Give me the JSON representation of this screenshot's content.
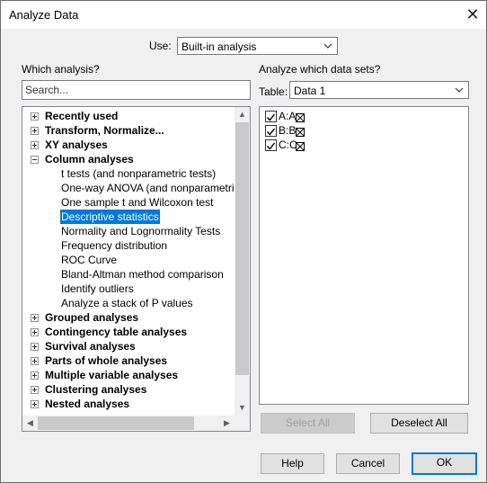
{
  "window": {
    "title": "Analyze Data",
    "close_glyph": "✕"
  },
  "use": {
    "label": "Use:",
    "value": "Built-in analysis"
  },
  "left": {
    "heading": "Which analysis?",
    "search_placeholder": "Search...",
    "tree": {
      "categories_top": [
        {
          "label": "Recently used",
          "expanded": false
        },
        {
          "label": "Transform, Normalize...",
          "expanded": false
        },
        {
          "label": "XY analyses",
          "expanded": false
        },
        {
          "label": "Column analyses",
          "expanded": true
        }
      ],
      "column_items": [
        {
          "label": "t tests (and nonparametric tests)",
          "selected": false
        },
        {
          "label": "One-way ANOVA (and nonparametric or",
          "selected": false
        },
        {
          "label": "One sample t and Wilcoxon test",
          "selected": false
        },
        {
          "label": "Descriptive statistics",
          "selected": true
        },
        {
          "label": "Normality and Lognormality Tests",
          "selected": false
        },
        {
          "label": "Frequency distribution",
          "selected": false
        },
        {
          "label": "ROC Curve",
          "selected": false
        },
        {
          "label": "Bland-Altman method comparison",
          "selected": false
        },
        {
          "label": "Identify outliers",
          "selected": false
        },
        {
          "label": "Analyze a stack of P values",
          "selected": false
        }
      ],
      "categories_bottom": [
        {
          "label": "Grouped analyses",
          "expanded": false
        },
        {
          "label": "Contingency table analyses",
          "expanded": false
        },
        {
          "label": "Survival analyses",
          "expanded": false
        },
        {
          "label": "Parts of whole analyses",
          "expanded": false
        },
        {
          "label": "Multiple variable analyses",
          "expanded": false
        },
        {
          "label": "Clustering analyses",
          "expanded": false
        },
        {
          "label": "Nested analyses",
          "expanded": false
        }
      ],
      "scroll_arrows": {
        "up": "▲",
        "down": "▼",
        "left": "◀",
        "right": "▶"
      }
    }
  },
  "right": {
    "heading": "Analyze which data sets?",
    "table_label": "Table:",
    "table_value": "Data 1",
    "datasets": [
      {
        "label": "A:A",
        "checked": true
      },
      {
        "label": "B:B",
        "checked": true
      },
      {
        "label": "C:C",
        "checked": true
      }
    ],
    "select_all": "Select All",
    "deselect_all": "Deselect All"
  },
  "buttons": {
    "help": "Help",
    "cancel": "Cancel",
    "ok": "OK"
  },
  "colors": {
    "selection": "#0078d7",
    "default_button_border": "#0078d7",
    "dialog_bg": "#f0f0f0"
  }
}
